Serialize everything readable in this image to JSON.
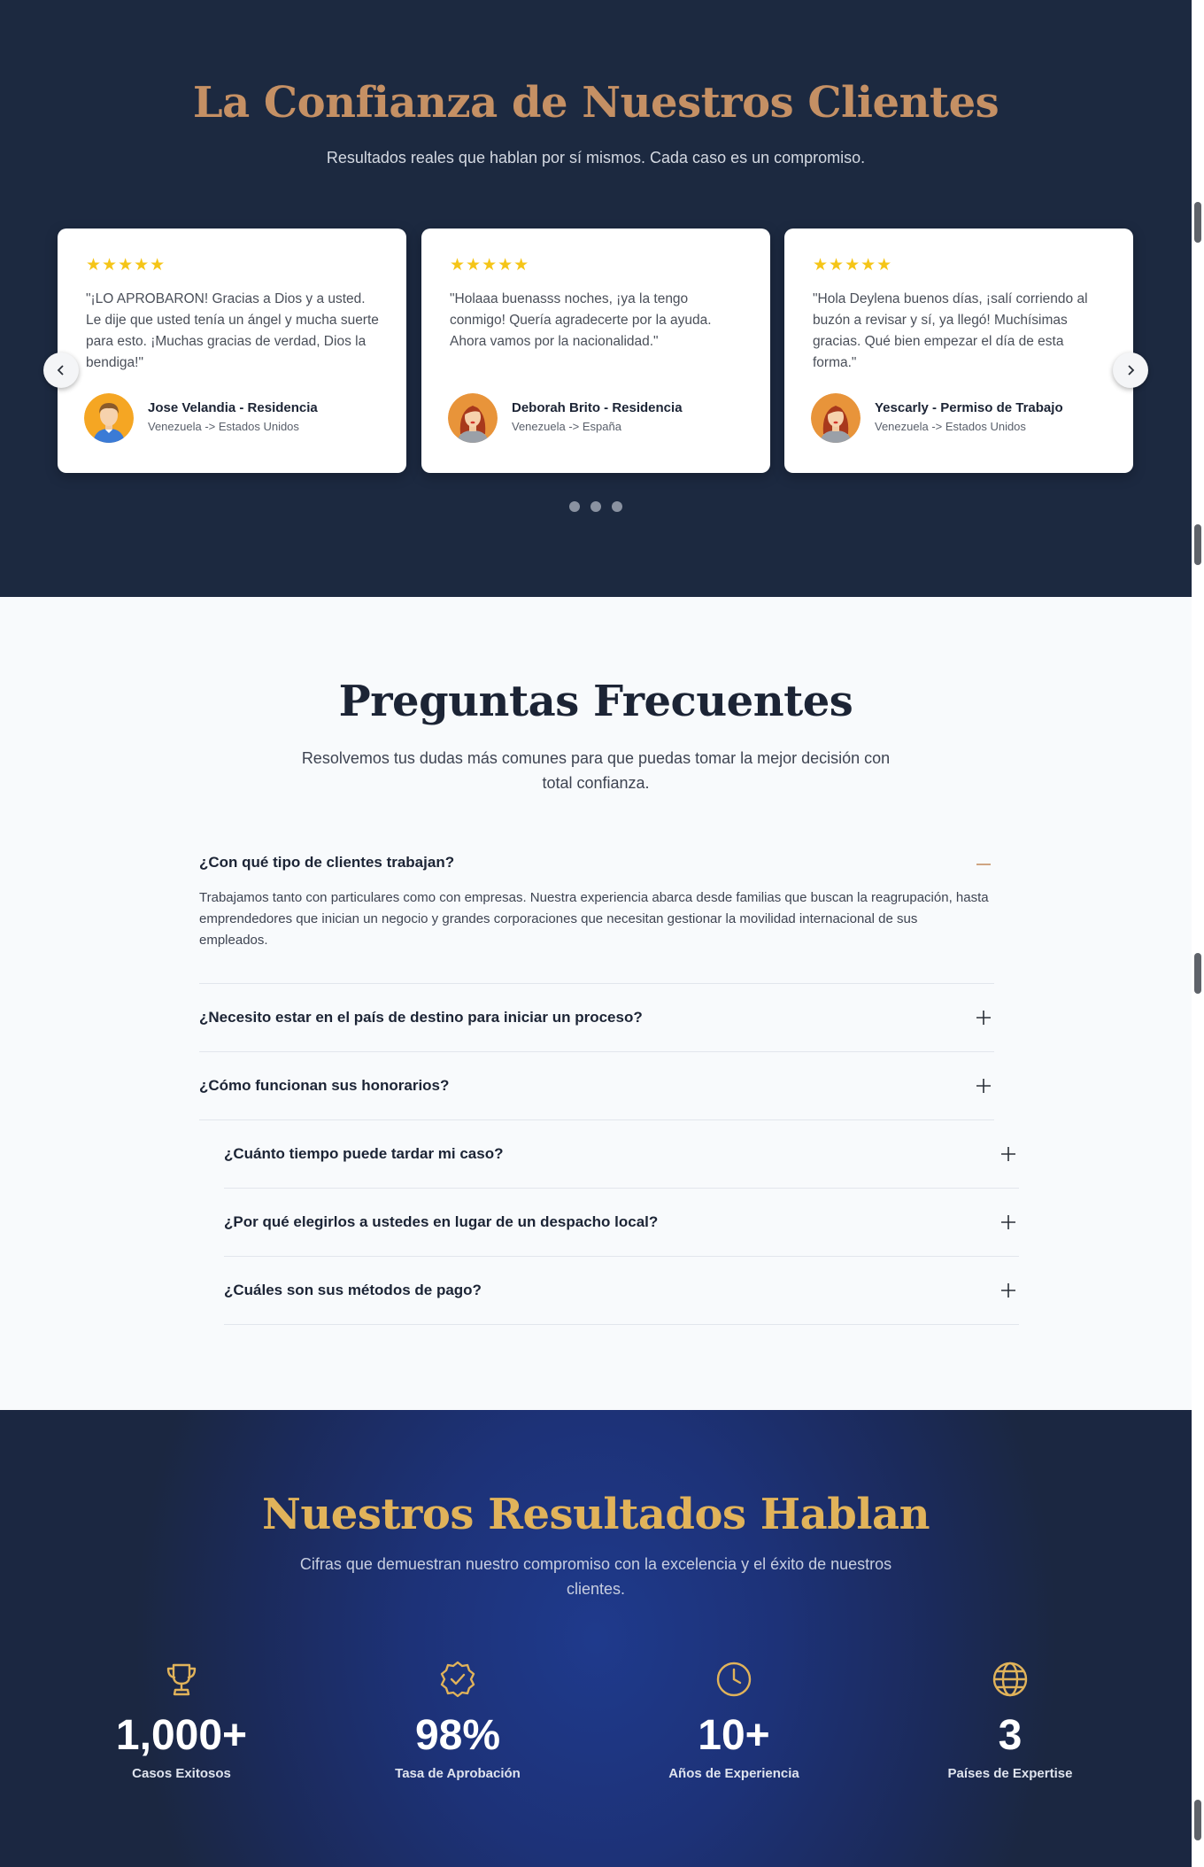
{
  "testimonials": {
    "title": "La Confianza de Nuestros Clientes",
    "subtitle": "Resultados reales que hablan por sí mismos. Cada caso es un compromiso.",
    "stars": "★★★★★",
    "cards": [
      {
        "quote": "\"¡LO APROBARON! Gracias a Dios y a usted. Le dije que usted tenía un ángel y mucha suerte para esto. ¡Muchas gracias de verdad, Dios la bendiga!\"",
        "name": "Jose Velandia - Residencia",
        "route": "Venezuela -> Estados Unidos",
        "avatar": "male-avatar-icon"
      },
      {
        "quote": "\"Holaaa buenasss noches, ¡ya la tengo conmigo! Quería agradecerte por la ayuda. Ahora vamos por la nacionalidad.\"",
        "name": "Deborah Brito - Residencia",
        "route": "Venezuela -> España",
        "avatar": "female-avatar-icon"
      },
      {
        "quote": "\"Hola Deylena buenos días, ¡salí corriendo al buzón a revisar y sí, ya llegó! Muchísimas gracias. Qué bien empezar el día de esta forma.\"",
        "name": "Yescarly - Permiso de Trabajo",
        "route": "Venezuela -> Estados Unidos",
        "avatar": "female-avatar-icon"
      }
    ],
    "carousel_dots": 3
  },
  "faq": {
    "title": "Preguntas Frecuentes",
    "subtitle": "Resolvemos tus dudas más comunes para que puedas tomar la mejor decisión con total confianza.",
    "items": [
      {
        "question": "¿Con qué tipo de clientes trabajan?",
        "answer": "Trabajamos tanto con particulares como con empresas. Nuestra experiencia abarca desde familias que buscan la reagrupación, hasta emprendedores que inician un negocio y grandes corporaciones que necesitan gestionar la movilidad internacional de sus empleados.",
        "expanded": true
      },
      {
        "question": "¿Necesito estar en el país de destino para iniciar un proceso?",
        "expanded": false
      },
      {
        "question": "¿Cómo funcionan sus honorarios?",
        "expanded": false
      },
      {
        "question": "¿Cuánto tiempo puede tardar mi caso?",
        "expanded": false
      },
      {
        "question": "¿Por qué elegirlos a ustedes en lugar de un despacho local?",
        "expanded": false
      },
      {
        "question": "¿Cuáles son sus métodos de pago?",
        "expanded": false
      }
    ]
  },
  "stats": {
    "title": "Nuestros Resultados Hablan",
    "subtitle": "Cifras que demuestran nuestro compromiso con la excelencia y el éxito de nuestros clientes.",
    "items": [
      {
        "icon": "trophy-icon",
        "value": "1,000+",
        "label": "Casos Exitosos"
      },
      {
        "icon": "badge-check-icon",
        "value": "98%",
        "label": "Tasa de Aprobación"
      },
      {
        "icon": "clock-icon",
        "value": "10+",
        "label": "Años de Experiencia"
      },
      {
        "icon": "globe-icon",
        "value": "3",
        "label": "Países de Expertise"
      }
    ]
  },
  "colors": {
    "navy": "#1c2940",
    "gold_title": "#c59064",
    "stats_gold": "#e1b35a",
    "star": "#f5c518"
  }
}
